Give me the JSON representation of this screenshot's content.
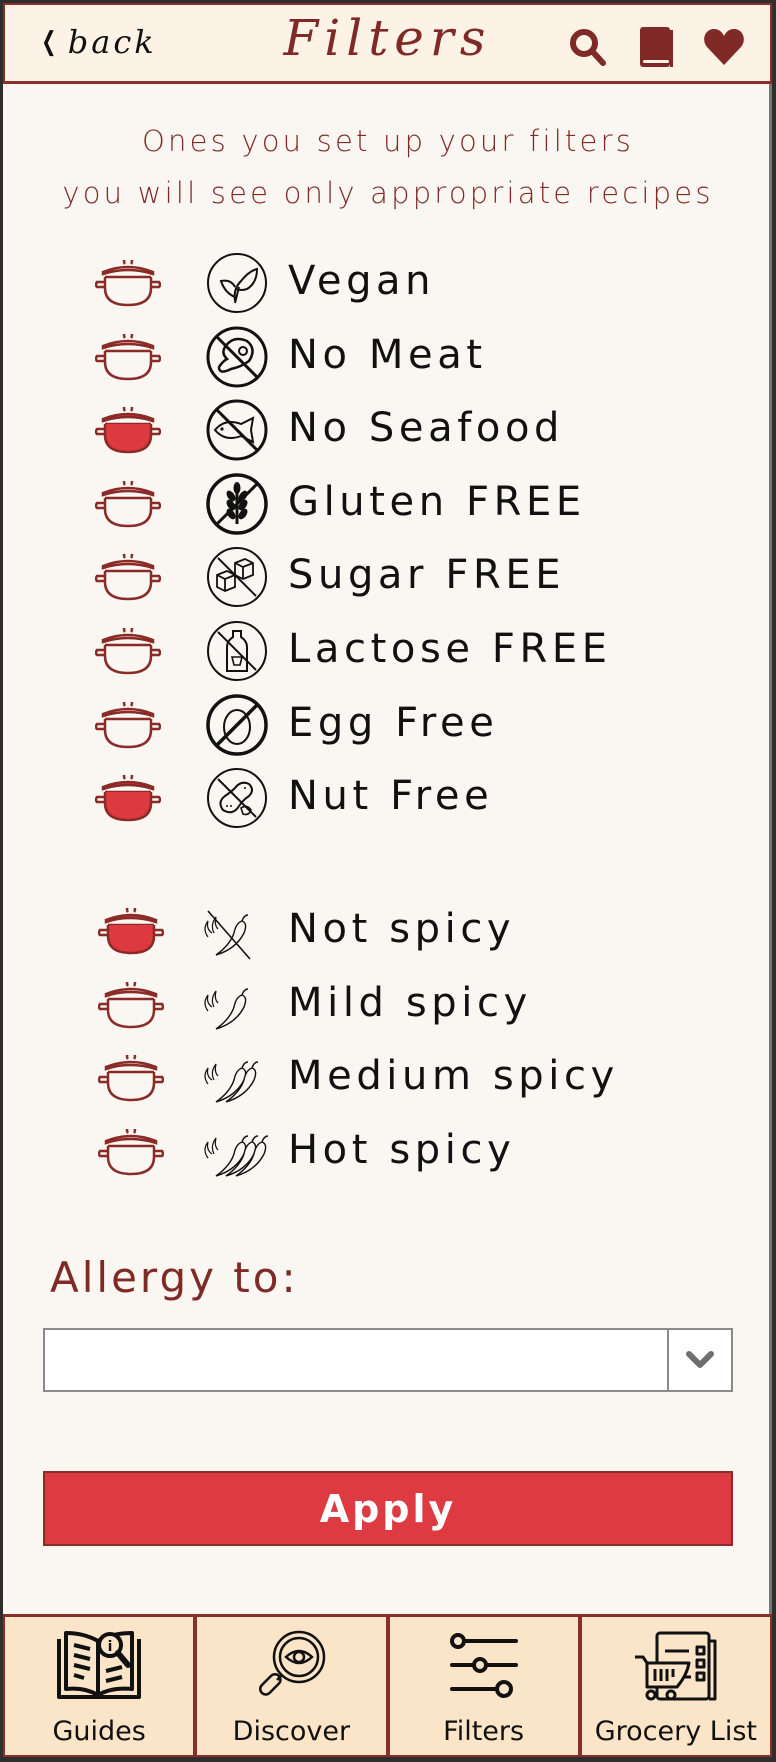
{
  "header": {
    "back_label": "back",
    "title": "Filters",
    "icons": [
      "search-icon",
      "book-icon",
      "heart-icon"
    ]
  },
  "subtitle": {
    "line1": "Ones you set up your filters",
    "line2": "you will see only appropriate recipes"
  },
  "diet_filters": [
    {
      "label": "Vegan",
      "icon": "leaf-icon",
      "selected": false
    },
    {
      "label": "No Meat",
      "icon": "no-meat-icon",
      "selected": false
    },
    {
      "label": "No Seafood",
      "icon": "no-fish-icon",
      "selected": true
    },
    {
      "label": "Gluten FREE",
      "icon": "no-wheat-icon",
      "selected": false
    },
    {
      "label": "Sugar FREE",
      "icon": "no-sugar-icon",
      "selected": false
    },
    {
      "label": "Lactose FREE",
      "icon": "no-milk-icon",
      "selected": false
    },
    {
      "label": "Egg Free",
      "icon": "no-egg-icon",
      "selected": false
    },
    {
      "label": "Nut Free",
      "icon": "no-nut-icon",
      "selected": true
    }
  ],
  "spicy_filters": [
    {
      "label": "Not spicy",
      "icon": "no-chili-icon",
      "selected": true
    },
    {
      "label": "Mild spicy",
      "icon": "one-chili-icon",
      "selected": false
    },
    {
      "label": "Medium spicy",
      "icon": "two-chili-icon",
      "selected": false
    },
    {
      "label": "Hot spicy",
      "icon": "three-chili-icon",
      "selected": false
    }
  ],
  "allergy": {
    "label": "Allergy to:",
    "value": ""
  },
  "apply_label": "Apply",
  "nav": {
    "tabs": [
      {
        "label": "Guides",
        "icon": "guide-book-icon"
      },
      {
        "label": "Discover",
        "icon": "discover-magnifier-icon"
      },
      {
        "label": "Filters",
        "icon": "sliders-icon"
      },
      {
        "label": "Grocery List",
        "icon": "grocery-cart-icon"
      }
    ]
  },
  "colors": {
    "accent": "#dd3a41",
    "brand_dark": "#7f2a27",
    "header_bg": "#fcf2e6",
    "content_bg": "#faf6f1",
    "nav_bg": "#fae5c8"
  }
}
